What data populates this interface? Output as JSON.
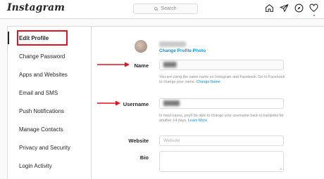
{
  "header": {
    "logo_text": "Instagram",
    "search_placeholder": "Search",
    "icons": [
      "home-icon",
      "direct-icon",
      "explore-icon",
      "activity-heart-icon"
    ]
  },
  "sidebar": {
    "items": [
      {
        "label": "Edit Profile",
        "active": true
      },
      {
        "label": "Change Password"
      },
      {
        "label": "Apps and Websites"
      },
      {
        "label": "Email and SMS"
      },
      {
        "label": "Push Notifications"
      },
      {
        "label": "Manage Contacts"
      },
      {
        "label": "Privacy and Security"
      },
      {
        "label": "Login Activity"
      }
    ]
  },
  "profile": {
    "change_photo_label": "Change Profile Photo"
  },
  "form": {
    "name": {
      "label": "Name",
      "help_text": "You are using the same name on Instagram and Facebook. Go to Facebook to change your name.",
      "help_link": "Change Name"
    },
    "username": {
      "label": "Username",
      "help_text": "In most cases, you'll be able to change your username back to kalopeka for another 14 days.",
      "help_link": "Learn More"
    },
    "website": {
      "label": "Website",
      "placeholder": "Website"
    },
    "bio": {
      "label": "Bio"
    }
  },
  "annotation_color": "#e0141e",
  "link_color": "#0095f6"
}
